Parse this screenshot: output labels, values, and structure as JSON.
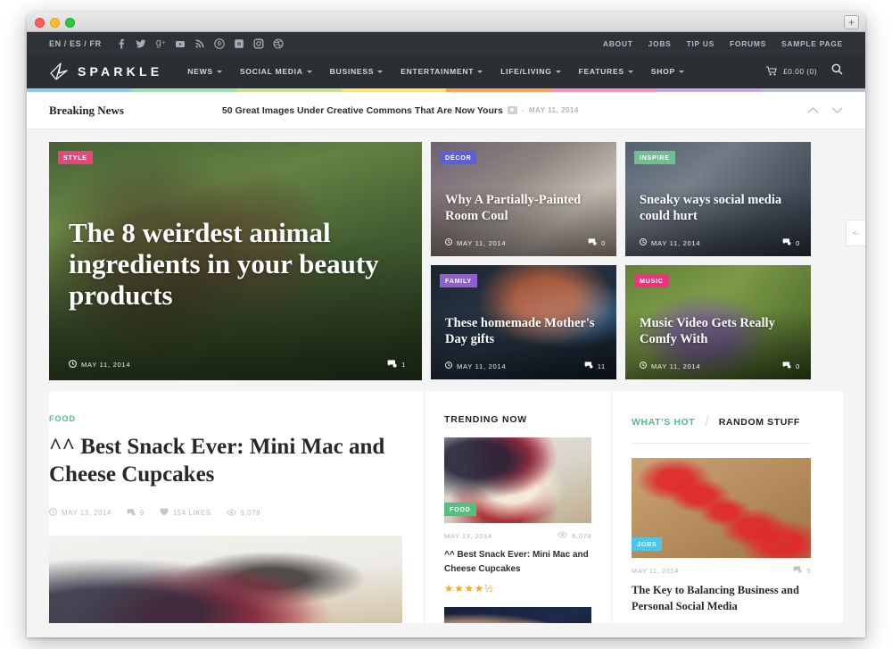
{
  "browser": {
    "new_tab_label": "+"
  },
  "topbar": {
    "languages": "EN / ES / FR",
    "social_icons": [
      "facebook-icon",
      "twitter-icon",
      "google-plus-icon",
      "youtube-icon",
      "rss-icon",
      "pinterest-icon",
      "vimeo-icon",
      "instagram-icon",
      "dribbble-icon"
    ],
    "links": [
      "ABOUT",
      "JOBS",
      "TIP US",
      "FORUMS",
      "SAMPLE PAGE"
    ]
  },
  "nav": {
    "brand": "SPARKLE",
    "menu": [
      "NEWS",
      "SOCIAL MEDIA",
      "BUSINESS",
      "ENTERTAINMENT",
      "LIFE/LIVING",
      "FEATURES",
      "SHOP"
    ],
    "cart_label": "£0.00 (0)",
    "search_label": "Search"
  },
  "color_strip": [
    "#8ecae6",
    "#9fe0b0",
    "#c6e48b",
    "#f9e37e",
    "#f9a05c",
    "#f48fb8",
    "#c3a8e0",
    "#b9bfcc"
  ],
  "breaking": {
    "label": "Breaking News",
    "headline": "50 Great Images Under Creative Commons That Are Now Yours",
    "separator": "-",
    "date": "MAY 11, 2014"
  },
  "features": {
    "hero": {
      "badge": "STYLE",
      "badge_color": "#e8457c",
      "title": "The 8 weirdest animal ingredients in your beauty products",
      "date": "MAY 11, 2014",
      "comments": "1"
    },
    "cards": [
      {
        "badge": "DÉCOR",
        "badge_color": "#5b5fdd",
        "title": "Why A Partially-Painted Room Coul",
        "date": "MAY 11, 2014",
        "comments": "0"
      },
      {
        "badge": "INSPIRE",
        "badge_color": "#6fbf8f",
        "title": "Sneaky ways social media could hurt",
        "date": "MAY 11, 2014",
        "comments": "0"
      },
      {
        "badge": "FAMILY",
        "badge_color": "#8d5fd3",
        "title": "These homemade Mother's Day gifts",
        "date": "MAY 11, 2014",
        "comments": "11"
      },
      {
        "badge": "MUSIC",
        "badge_color": "#f0317e",
        "title": "Music Video Gets Really Comfy With",
        "date": "MAY 11, 2014",
        "comments": "0"
      }
    ]
  },
  "main_post": {
    "category": "FOOD",
    "title": "^^ Best Snack Ever: Mini Mac and Cheese Cupcakes",
    "date": "MAY 13, 2014",
    "comments": "9",
    "likes": "154 LIKES",
    "views": "6,078"
  },
  "trending": {
    "heading": "TRENDING NOW",
    "items": [
      {
        "badge": "FOOD",
        "badge_color": "#4fc37e",
        "date": "MAY 13, 2014",
        "views": "6,078",
        "title": "^^ Best Snack Ever: Mini Mac and Cheese Cupcakes",
        "rating": "★★★★½"
      }
    ]
  },
  "sidebar": {
    "tabs": [
      {
        "label": "WHAT'S HOT",
        "active": true
      },
      {
        "label": "RANDOM STUFF",
        "active": false
      }
    ],
    "tab_separator": "/",
    "item": {
      "badge": "JOBS",
      "badge_color": "#4ec5e8",
      "date": "MAY 11, 2014",
      "comments": "5",
      "title": "The Key to Balancing Business and Personal Social Media"
    }
  },
  "edge_tab": {
    "label": "<-"
  }
}
